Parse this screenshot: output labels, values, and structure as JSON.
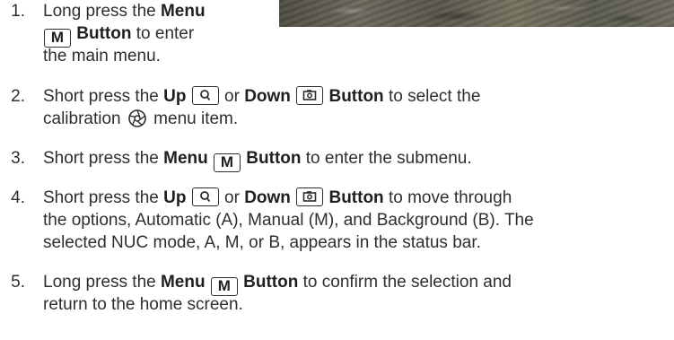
{
  "steps": [
    {
      "number": "1.",
      "line1": {
        "lead": "Long press the ",
        "strong": "Menu"
      },
      "line2": {
        "key": "M",
        "strong": "Button",
        "trail": " to enter"
      },
      "line3": "the main menu."
    },
    {
      "number": "2.",
      "line1": {
        "lead": "Short press the ",
        "strong1": "Up",
        "or": " or ",
        "strong2": "Down",
        "strong3": "Button",
        "trail": " to select the"
      },
      "line2": {
        "lead": "calibration ",
        "trail": " menu item."
      }
    },
    {
      "number": "3.",
      "line1": {
        "lead": "Short press the ",
        "strong": "Menu",
        "key": "M",
        "strong2": "Button",
        "trail": " to enter the submenu."
      }
    },
    {
      "number": "4.",
      "line1": {
        "lead": "Short press the ",
        "strong1": "Up",
        "or": " or ",
        "strong2": "Down",
        "strong3": "Button",
        "trail": " to move through"
      },
      "line2": "the options, Automatic (A), Manual (M), and Background (B). The",
      "line3": "selected NUC mode, A, M, or B, appears in the status bar."
    },
    {
      "number": "5.",
      "line1": {
        "lead": "Long press the ",
        "strong": "Menu",
        "key": "M",
        "strong2": "Button",
        "trail": " to confirm the selection and"
      },
      "line2": "return to the home screen."
    }
  ],
  "icons": {
    "up_button": "zoom-magnifier-icon",
    "down_button": "camera-capture-icon",
    "calibration": "calibration-shutter-icon"
  },
  "colors": {
    "text": "#2e2e2e",
    "key_border": "#2e2e2e"
  }
}
